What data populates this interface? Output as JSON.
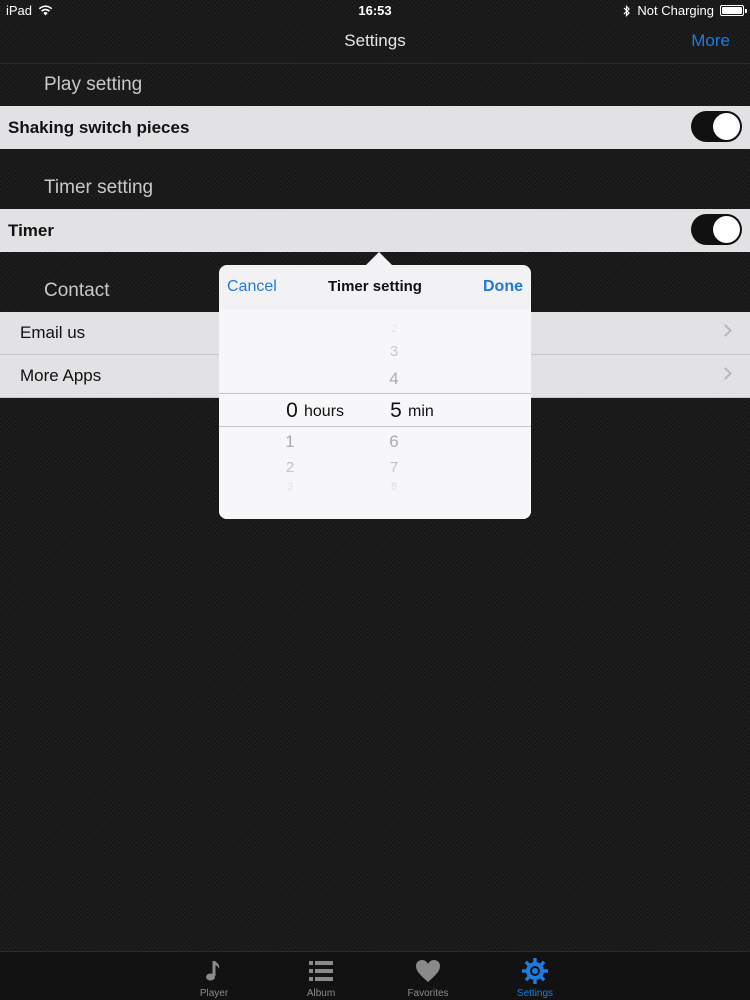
{
  "status_bar": {
    "device": "iPad",
    "time": "16:53",
    "charging": "Not Charging"
  },
  "nav": {
    "title": "Settings",
    "right_button": "More"
  },
  "sections": {
    "play": {
      "header": "Play setting",
      "row_label": "Shaking switch pieces",
      "toggle_on": true
    },
    "timer": {
      "header": "Timer setting",
      "row_label": "Timer",
      "toggle_on": true
    },
    "contact": {
      "header": "Contact",
      "rows": [
        "Email us",
        "More Apps"
      ]
    }
  },
  "popover": {
    "cancel": "Cancel",
    "title": "Timer setting",
    "done": "Done",
    "hours_unit": "hours",
    "min_unit": "min",
    "hours_selected": "0",
    "min_selected": "5",
    "hours_below": [
      "1",
      "2",
      "3"
    ],
    "min_above": [
      "2",
      "3",
      "4"
    ],
    "min_below": [
      "6",
      "7",
      "8"
    ]
  },
  "tabs": [
    {
      "label": "Player",
      "icon": "music-note-icon"
    },
    {
      "label": "Album",
      "icon": "list-icon"
    },
    {
      "label": "Favorites",
      "icon": "heart-icon"
    },
    {
      "label": "Settings",
      "icon": "gear-icon",
      "active": true
    }
  ],
  "colors": {
    "accent": "#1e7be0",
    "background": "#1b1b1c",
    "cell": "#e2e2e4"
  }
}
